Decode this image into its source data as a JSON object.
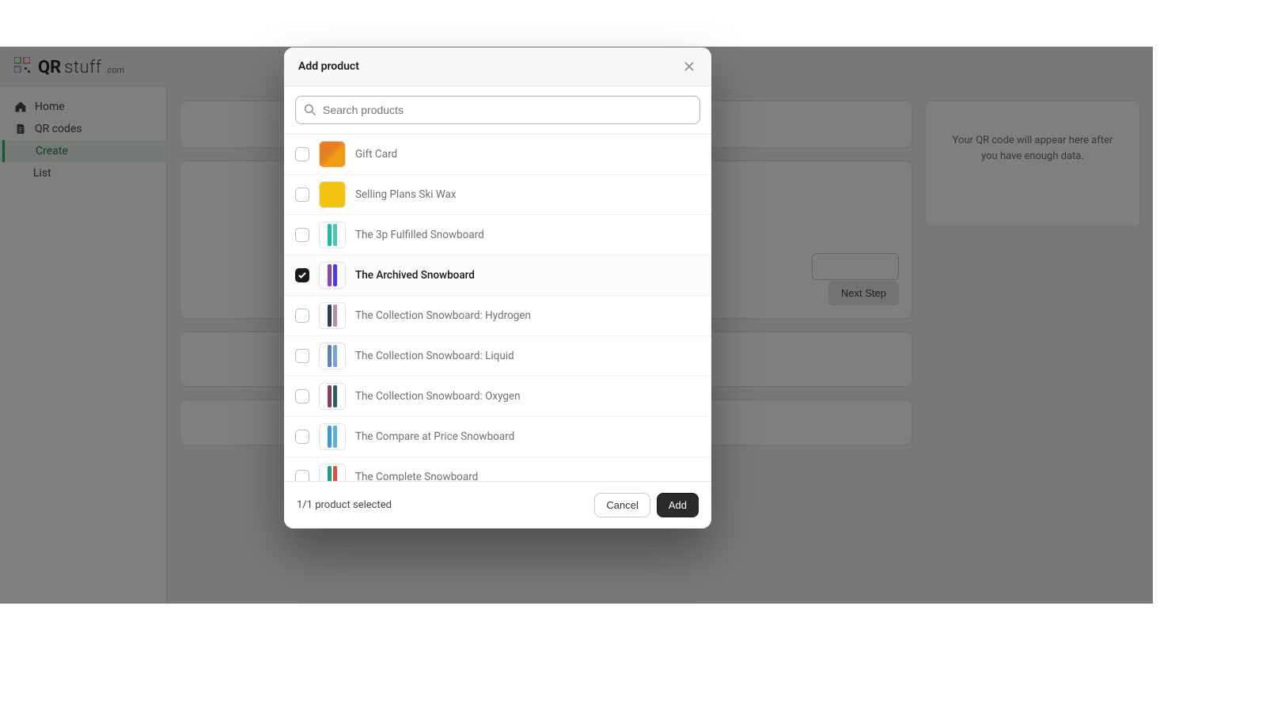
{
  "brand": {
    "qr": "QR",
    "stuff": "stuff",
    "com": ".com"
  },
  "sidebar": {
    "home": "Home",
    "qrcodes": "QR codes",
    "create": "Create",
    "list": "List"
  },
  "background": {
    "next_step": "Next Step",
    "preview_text": "Your QR code will appear here after you have enough data."
  },
  "modal": {
    "title": "Add product",
    "search_placeholder": "Search products",
    "selected_count": "1/1 product selected",
    "cancel": "Cancel",
    "add": "Add"
  },
  "products": [
    {
      "name": "Gift Card",
      "selected": false,
      "thumb": "gift",
      "colors": []
    },
    {
      "name": "Selling Plans Ski Wax",
      "selected": false,
      "thumb": "wax",
      "colors": []
    },
    {
      "name": "The 3p Fulfilled Snowboard",
      "selected": false,
      "thumb": "board",
      "colors": [
        "#1abc9c",
        "#48c9b0"
      ]
    },
    {
      "name": "The Archived Snowboard",
      "selected": true,
      "thumb": "board",
      "colors": [
        "#8e44ad",
        "#4a3aff"
      ]
    },
    {
      "name": "The Collection Snowboard: Hydrogen",
      "selected": false,
      "thumb": "board",
      "colors": [
        "#2c3e50",
        "#b48ead"
      ]
    },
    {
      "name": "The Collection Snowboard: Liquid",
      "selected": false,
      "thumb": "board",
      "colors": [
        "#5b7fb8",
        "#7ca3d4"
      ]
    },
    {
      "name": "The Collection Snowboard: Oxygen",
      "selected": false,
      "thumb": "board",
      "colors": [
        "#8b3a62",
        "#2c5d6e"
      ]
    },
    {
      "name": "The Compare at Price Snowboard",
      "selected": false,
      "thumb": "board",
      "colors": [
        "#3498db",
        "#5dade2"
      ]
    },
    {
      "name": "The Complete Snowboard",
      "selected": false,
      "thumb": "board",
      "colors": [
        "#16a085",
        "#e74c3c"
      ]
    }
  ]
}
